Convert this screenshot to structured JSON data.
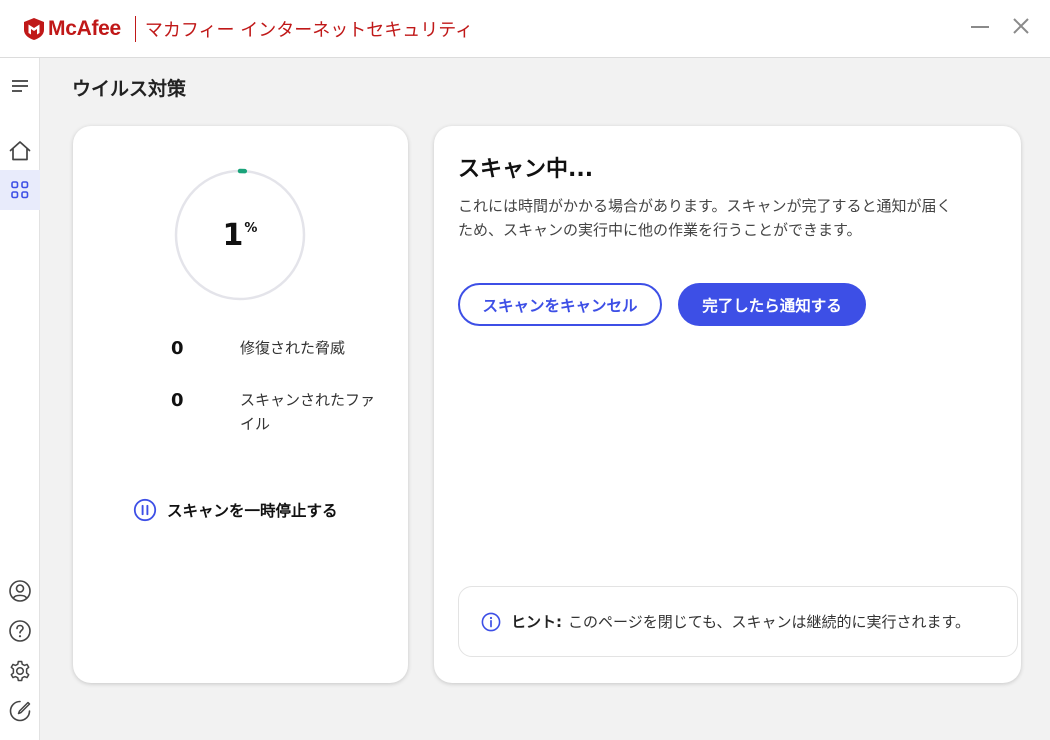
{
  "window": {
    "brand": "McAfee",
    "product_name": "マカフィー インターネットセキュリティ",
    "brand_color": "#c01818",
    "minimize_icon": "minimize-icon",
    "close_icon": "close-icon"
  },
  "sidebar": {
    "items": [
      {
        "id": "menu",
        "icon": "hamburger-menu-icon"
      },
      {
        "id": "home",
        "icon": "home-icon"
      },
      {
        "id": "apps",
        "icon": "grid-icon",
        "active": true
      },
      {
        "id": "account",
        "icon": "user-icon"
      },
      {
        "id": "help",
        "icon": "help-icon"
      },
      {
        "id": "settings",
        "icon": "gear-icon"
      },
      {
        "id": "feedback",
        "icon": "edit-icon"
      }
    ],
    "active_color": "#e8ebfb"
  },
  "page": {
    "title": "ウイルス対策"
  },
  "scan_status": {
    "progress_value": "1",
    "progress_unit": "%",
    "progress_fraction": 0.01,
    "progress_color": "#1aa37a",
    "stats": [
      {
        "value": "0",
        "label": "修復された脅威"
      },
      {
        "value": "0",
        "label": "スキャンされたファイル"
      }
    ],
    "pause_label": "スキャンを一時停止する",
    "pause_icon": "pause-circle-icon"
  },
  "scan_panel": {
    "title": "スキャン中...",
    "description": "これには時間がかかる場合があります。スキャンが完了すると通知が届くため、スキャンの実行中に他の作業を行うことができます。",
    "cancel_button": "スキャンをキャンセル",
    "notify_button": "完了したら通知する",
    "accent_color": "#3d4fe6",
    "hint": {
      "icon": "info-icon",
      "label": "ヒント:",
      "text": "このページを閉じても、スキャンは継続的に実行されます。"
    }
  }
}
